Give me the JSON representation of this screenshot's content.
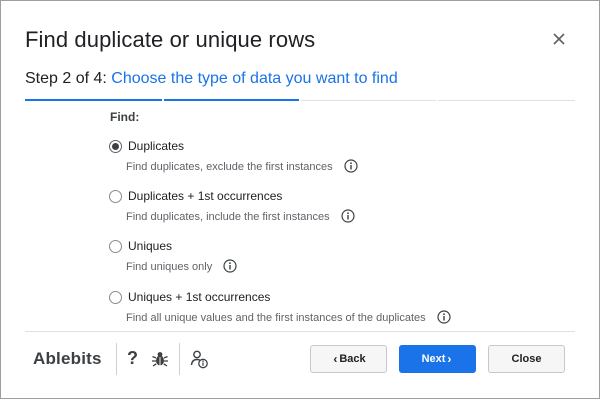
{
  "dialog": {
    "title": "Find duplicate or unique rows",
    "step_number": "Step 2 of 4:",
    "step_description": "Choose the type of data you want to find"
  },
  "find": {
    "label": "Find:",
    "options": [
      {
        "label": "Duplicates",
        "description": "Find duplicates, exclude the first instances",
        "selected": true
      },
      {
        "label": "Duplicates + 1st occurrences",
        "description": "Find duplicates, include the first instances",
        "selected": false
      },
      {
        "label": "Uniques",
        "description": "Find uniques only",
        "selected": false
      },
      {
        "label": "Uniques + 1st occurrences",
        "description": "Find all unique values and the first instances of the duplicates",
        "selected": false
      }
    ]
  },
  "footer": {
    "brand": "Ablebits",
    "help_label": "?",
    "back_label": "Back",
    "next_label": "Next",
    "close_label": "Close"
  },
  "progress": {
    "current_step": 2,
    "total_steps": 4
  },
  "colors": {
    "accent": "#1a73e8",
    "text": "#202124",
    "muted": "#5f6368"
  }
}
